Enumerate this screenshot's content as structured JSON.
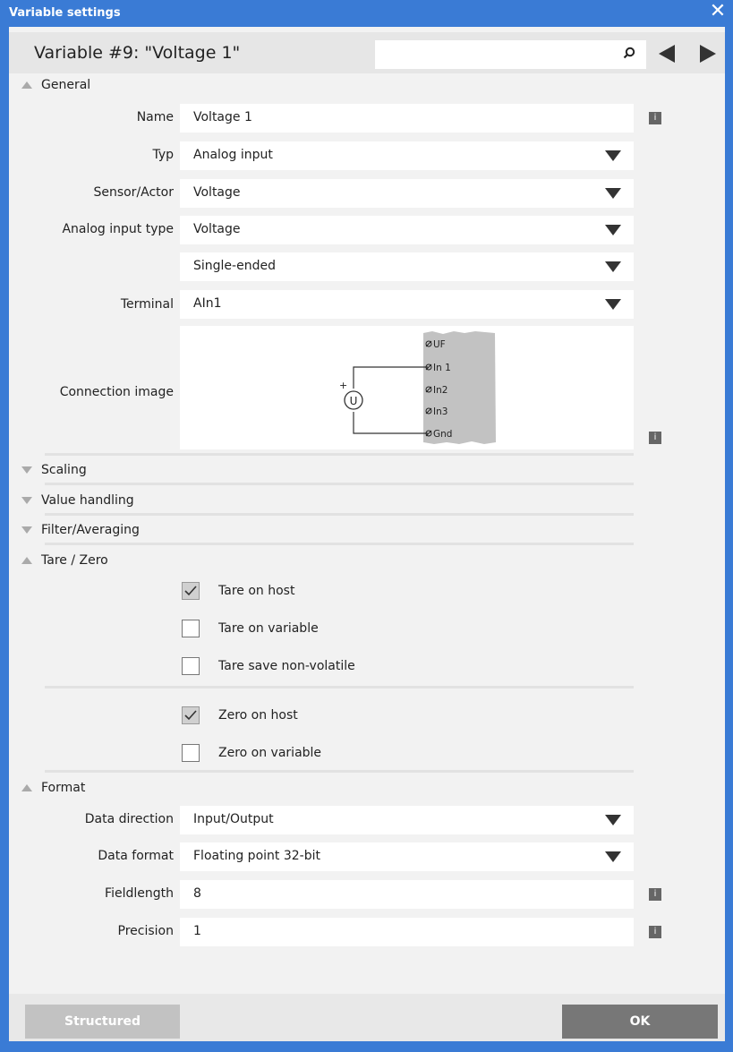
{
  "window": {
    "title": "Variable settings",
    "close": "✕"
  },
  "header": {
    "title": "Variable #9: \"Voltage 1\"",
    "search_value": ""
  },
  "sections": {
    "general": "General",
    "scaling": "Scaling",
    "value_handling": "Value handling",
    "filter": "Filter/Averaging",
    "tare": "Tare / Zero",
    "format": "Format"
  },
  "general": {
    "name_label": "Name",
    "name_value": "Voltage 1",
    "typ_label": "Typ",
    "typ_value": "Analog input",
    "sensor_label": "Sensor/Actor",
    "sensor_value": "Voltage",
    "ait_label": "Analog input type",
    "ait_value": "Voltage",
    "mode_value": "Single-ended",
    "terminal_label": "Terminal",
    "terminal_value": "AIn1",
    "connection_label": "Connection image",
    "diagram": {
      "pins": [
        "UF",
        "In 1",
        "In2",
        "In3",
        "Gnd"
      ],
      "source": "U",
      "plus": "+"
    }
  },
  "tare": {
    "tare_on_host": {
      "label": "Tare on host",
      "checked": true
    },
    "tare_on_variable": {
      "label": "Tare on variable",
      "checked": false
    },
    "tare_save": {
      "label": "Tare save non-volatile",
      "checked": false
    },
    "zero_on_host": {
      "label": "Zero on host",
      "checked": true
    },
    "zero_on_variable": {
      "label": "Zero on variable",
      "checked": false
    }
  },
  "format": {
    "direction_label": "Data direction",
    "direction_value": "Input/Output",
    "dformat_label": "Data format",
    "dformat_value": "Floating point 32-bit",
    "fieldlength_label": "Fieldlength",
    "fieldlength_value": "8",
    "precision_label": "Precision",
    "precision_value": "1"
  },
  "info_glyph": "i",
  "buttons": {
    "structured": "Structured",
    "ok": "OK"
  },
  "colors": {
    "title_bar": "#3a7bd5",
    "panel": "#f2f2f2",
    "structured_btn": "#c2c2c2",
    "ok_btn": "#777777"
  }
}
